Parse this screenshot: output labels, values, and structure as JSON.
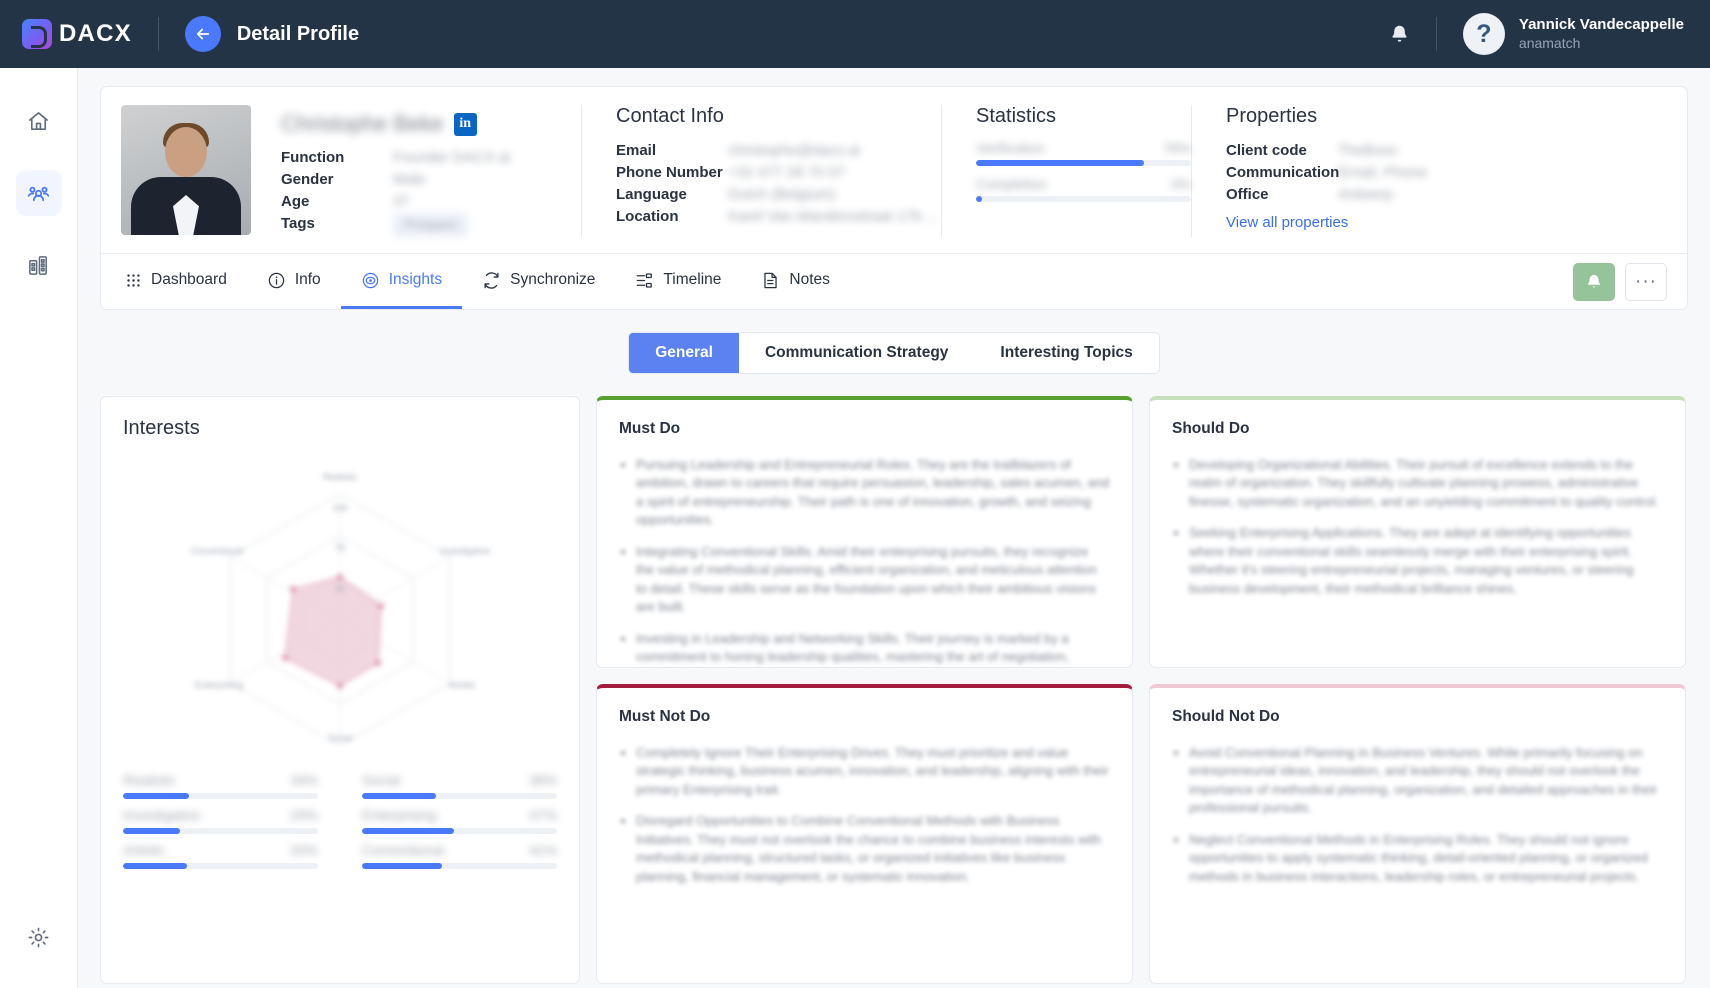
{
  "topbar": {
    "brand": "DACX",
    "brand_icon": "dacx-logo-icon",
    "back_icon": "arrow-left-icon",
    "page_title": "Detail Profile",
    "bell_icon": "bell-icon",
    "avatar_glyph": "?",
    "user_name": "Yannick Vandecappelle",
    "user_org": "anamatch"
  },
  "sidebar": {
    "items": [
      {
        "name": "home",
        "icon": "home-icon",
        "active": false
      },
      {
        "name": "people",
        "icon": "people-icon",
        "active": true
      },
      {
        "name": "companies",
        "icon": "building-icon",
        "active": false
      }
    ],
    "settings": {
      "name": "settings",
      "icon": "gear-icon"
    }
  },
  "profile": {
    "name": "Christophe Beke",
    "linkedin_badge": "in",
    "fields": [
      {
        "label": "Function",
        "value": "Founder DACX.ai",
        "redacted": true
      },
      {
        "label": "Gender",
        "value": "Male",
        "redacted": true
      },
      {
        "label": "Age",
        "value": "37",
        "redacted": true
      },
      {
        "label": "Tags",
        "value": "Prospect",
        "redacted": true,
        "chip": true
      }
    ]
  },
  "contact": {
    "title": "Contact Info",
    "fields": [
      {
        "label": "Email",
        "value": "christophe@dacx.ai",
        "redacted": true
      },
      {
        "label": "Phone Number",
        "value": "+32 477 28 70 07",
        "redacted": true
      },
      {
        "label": "Language",
        "value": "Dutch (Belgium)",
        "redacted": true
      },
      {
        "label": "Location",
        "value": "Karel Van Mandersstraat 17b ...",
        "redacted": true
      }
    ]
  },
  "statistics": {
    "title": "Statistics",
    "rows": [
      {
        "label": "Verification",
        "value": "78%",
        "percent": 78,
        "redacted": true
      },
      {
        "label": "Completion",
        "value": "3%",
        "percent": 3,
        "redacted": true
      }
    ]
  },
  "properties": {
    "title": "Properties",
    "fields": [
      {
        "label": "Client code",
        "value": "TheBoss",
        "redacted": true
      },
      {
        "label": "Communication",
        "value": "Email, Phone",
        "redacted": true
      },
      {
        "label": "Office",
        "value": "Antwerp",
        "redacted": true
      }
    ],
    "view_all_label": "View all properties"
  },
  "tabs": [
    {
      "label": "Dashboard",
      "icon": "grid-dots-icon",
      "active": false
    },
    {
      "label": "Info",
      "icon": "info-circle-icon",
      "active": false
    },
    {
      "label": "Insights",
      "icon": "eye-circle-icon",
      "active": true
    },
    {
      "label": "Synchronize",
      "icon": "refresh-icon",
      "active": false
    },
    {
      "label": "Timeline",
      "icon": "timeline-icon",
      "active": false
    },
    {
      "label": "Notes",
      "icon": "note-icon",
      "active": false
    }
  ],
  "tab_actions": {
    "primary_icon": "bell-upload-icon",
    "more_label": "···"
  },
  "segmented": {
    "items": [
      {
        "label": "General",
        "active": true
      },
      {
        "label": "Communication Strategy",
        "active": false
      },
      {
        "label": "Interesting Topics",
        "active": false
      }
    ]
  },
  "interests": {
    "title": "Interests"
  },
  "chart_data": {
    "type": "radar",
    "title": "Interests",
    "categories": [
      "Realistic",
      "Investigative",
      "Artistic",
      "Social",
      "Enterprising",
      "Conventional"
    ],
    "values": [
      34,
      29,
      33,
      38,
      47,
      41
    ],
    "rlim": [
      0,
      100
    ],
    "tick_labels": [
      "100",
      "75",
      "50"
    ],
    "grid": true,
    "legend": "none",
    "series_color": "#e9a8bd",
    "redacted_labels": true
  },
  "riasec": {
    "items": [
      {
        "label": "Realistic",
        "value": "34%",
        "percent": 34
      },
      {
        "label": "Social",
        "value": "38%",
        "percent": 38
      },
      {
        "label": "Investigative",
        "value": "29%",
        "percent": 29
      },
      {
        "label": "Enterprising",
        "value": "47%",
        "percent": 47
      },
      {
        "label": "Artistic",
        "value": "33%",
        "percent": 33
      },
      {
        "label": "Conventional",
        "value": "41%",
        "percent": 41
      }
    ]
  },
  "advice": {
    "must_do": {
      "title": "Must Do",
      "accent": "#56a032",
      "items": [
        "Pursuing Leadership and Entrepreneurial Roles. They are the trailblazers of ambition, drawn to careers that require persuasion, leadership, sales acumen, and a spirit of entrepreneurship. Their path is one of innovation, growth, and seizing opportunities.",
        "Integrating Conventional Skills. Amid their enterprising pursuits, they recognize the value of methodical planning, efficient organization, and meticulous attention to detail. These skills serve as the foundation upon which their ambitious visions are built.",
        "Investing in Leadership and Networking Skills. Their journey is marked by a commitment to honing leadership qualities, mastering the art of negotiation, refining the power of persuasion, and cultivating a network of professional connections that amplifies their impact."
      ]
    },
    "should_do": {
      "title": "Should Do",
      "accent": "#c6e0bc",
      "items": [
        "Developing Organizational Abilities. Their pursuit of excellence extends to the realm of organization. They skillfully cultivate planning prowess, administrative finesse, systematic organization, and an unyielding commitment to quality control.",
        "Seeking Enterprising Applications. They are adept at identifying opportunities where their conventional skills seamlessly merge with their enterprising spirit. Whether it's steering entrepreneurial projects, managing ventures, or steering business development, their methodical brilliance shines."
      ]
    },
    "must_not_do": {
      "title": "Must Not Do",
      "accent": "#a31d3e",
      "items": [
        "Completely Ignore Their Enterprising Drives. They must prioritize and value strategic thinking, business acumen, innovation, and leadership, aligning with their primary Enterprising trait.",
        "Disregard Opportunities to Combine Conventional Methods with Business Initiatives. They must not overlook the chance to combine business interests with methodical planning, structured tasks, or organized initiatives like business planning, financial management, or systematic innovation."
      ]
    },
    "should_not_do": {
      "title": "Should Not Do",
      "accent": "#efc9d3",
      "items": [
        "Avoid Conventional Planning in Business Ventures. While primarily focusing on entrepreneurial ideas, innovation, and leadership, they should not overlook the importance of methodical planning, organization, and detailed approaches in their professional pursuits.",
        "Neglect Conventional Methods in Enterprising Roles. They should not ignore opportunities to apply systematic thinking, detail-oriented planning, or organized methods in business interactions, leadership roles, or entrepreneurial projects."
      ]
    }
  }
}
